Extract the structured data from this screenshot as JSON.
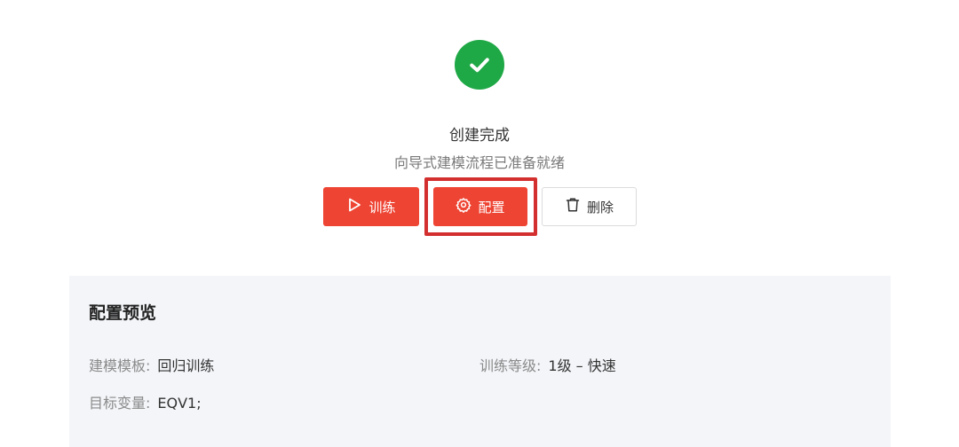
{
  "status": {
    "title": "创建完成",
    "subtitle": "向导式建模流程已准备就绪",
    "success_color": "#1fa846"
  },
  "actions": {
    "train_label": "训练",
    "config_label": "配置",
    "delete_label": "删除",
    "primary_color": "#ee4433",
    "highlight_color": "#d32f2f"
  },
  "preview": {
    "title": "配置预览",
    "template_label": "建模模板:",
    "template_value": "回归训练",
    "level_label": "训练等级:",
    "level_value": "1级 – 快速",
    "target_label": "目标变量:",
    "target_value": "EQV1;"
  }
}
